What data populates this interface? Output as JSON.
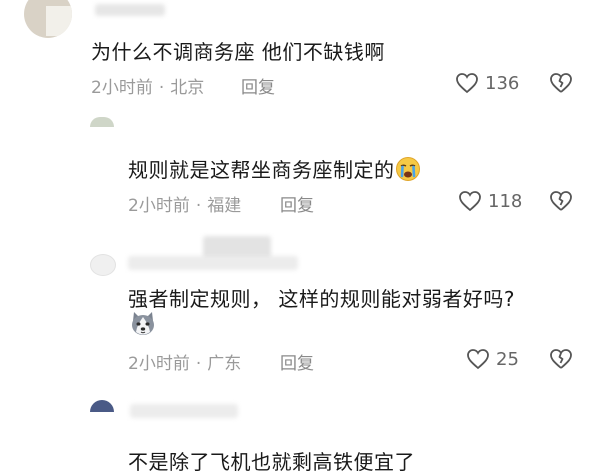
{
  "comments": [
    {
      "text": "为什么不调商务座 他们不缺钱啊",
      "time": "2小时前",
      "location": "北京",
      "reply_label": "回复",
      "likes": "136"
    },
    {
      "text": "规则就是这帮坐商务座制定的",
      "emoji": "crying-face",
      "time": "2小时前",
      "location": "福建",
      "reply_label": "回复",
      "likes": "118"
    },
    {
      "text": "强者制定规则， 这样的规则能对弱者好吗?",
      "emoji": "husky-dog-face",
      "time": "2小时前",
      "location": "广东",
      "reply_label": "回复",
      "likes": "25"
    },
    {
      "text": "不是除了飞机也就剩高铁便宜了"
    }
  ],
  "separator": "·",
  "colors": {
    "text": "#1a1a1a",
    "meta": "#9a9a9a",
    "icon": "#555555"
  }
}
